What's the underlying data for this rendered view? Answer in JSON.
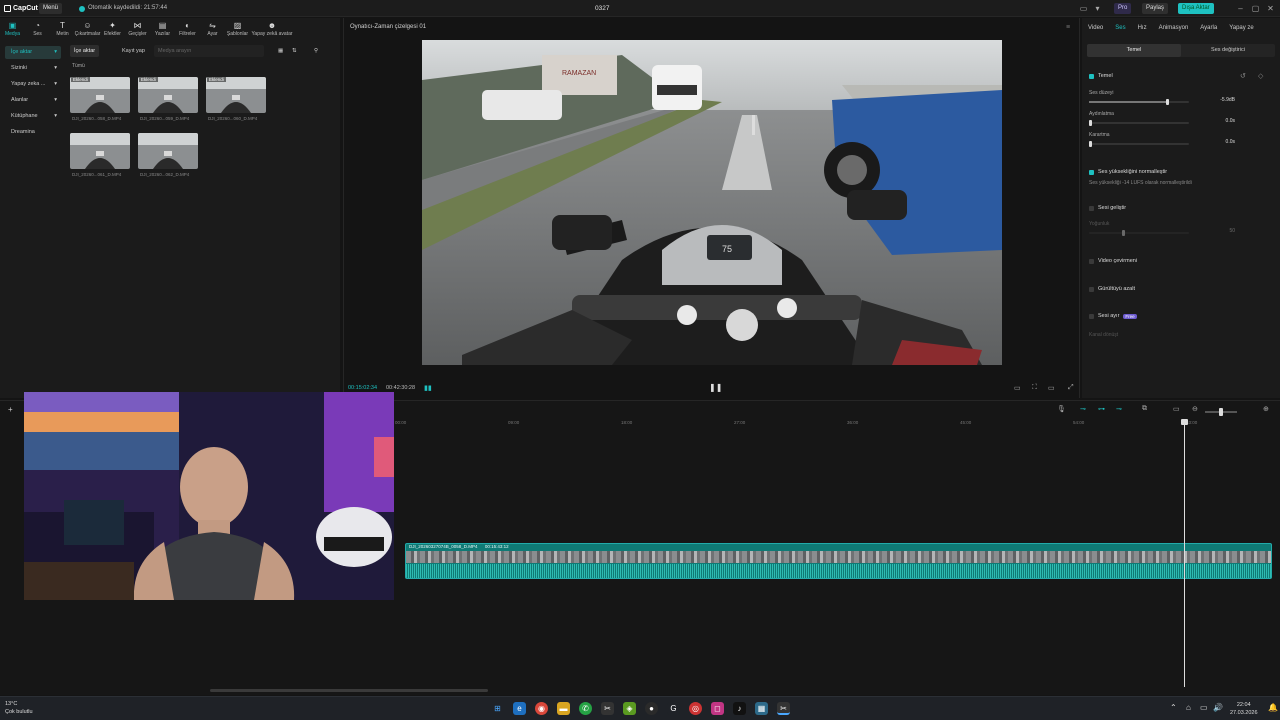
{
  "titlebar": {
    "logo": "CapCut",
    "menu": "Menü",
    "autosave": "Otomatik kaydedildi: 21:57:44",
    "project": "0327",
    "pro": "Pro",
    "share": "Paylaş",
    "export": "Dışa Aktar"
  },
  "toolbar": {
    "items": [
      {
        "label": "Medya",
        "icon": "media-icon"
      },
      {
        "label": "Ses",
        "icon": "audio-icon"
      },
      {
        "label": "Metin",
        "icon": "text-icon"
      },
      {
        "label": "Çıkartmalar",
        "icon": "sticker-icon"
      },
      {
        "label": "Efektler",
        "icon": "effects-icon"
      },
      {
        "label": "Geçişler",
        "icon": "transitions-icon"
      },
      {
        "label": "Yazılar",
        "icon": "captions-icon"
      },
      {
        "label": "Filtreler",
        "icon": "filters-icon"
      },
      {
        "label": "Ayar",
        "icon": "adjust-icon"
      },
      {
        "label": "Şablonlar",
        "icon": "templates-icon"
      },
      {
        "label": "Yapay zekâ avatar",
        "icon": "ai-avatar-icon"
      }
    ]
  },
  "sidebar": {
    "items": [
      "İçe aktar",
      "Sizinki",
      "Yapay zeka ...",
      "Alanlar",
      "Kütüphane",
      "Dreamina"
    ]
  },
  "media": {
    "import_label": "İçe aktar",
    "record_label": "Kayıt yap",
    "search_placeholder": "Medya arayın",
    "filter_all": "Tümü",
    "added_badge": "Eklendi",
    "files": [
      "DJI_20260...058_D.MP4",
      "DJI_20260...059_D.MP4",
      "DJI_20260...060_D.MP4",
      "DJI_20260...061_D.MP4",
      "DJI_20260...062_D.MP4"
    ]
  },
  "player": {
    "title": "Oynatıcı-Zaman çizelgesi 01",
    "current_time": "00:15:02:34",
    "total_time": "00:42:30:28",
    "dash_readout": "75"
  },
  "inspector": {
    "tabs": [
      "Video",
      "Ses",
      "Hız",
      "Animasyon",
      "Ayarla",
      "Yapay ze"
    ],
    "subtabs": [
      "Temel",
      "Ses değiştirici"
    ],
    "section_basic": "Temel",
    "volume_label": "Ses düzeyi",
    "volume_value": "-5.9dB",
    "volume_fraction": 0.78,
    "fadein_label": "Aydınlatma",
    "fadein_value": "0.0s",
    "fadeout_label": "Karartma",
    "fadeout_value": "0.0s",
    "normalize_label": "Ses yüksekliğini normalleştir",
    "normalize_desc": "Ses yüksekliği -14 LUFS olarak normalleştirildi",
    "enhance_label": "Sesi geliştir",
    "enhance_sub": "Yoğunluk",
    "enhance_value": "50",
    "translate_label": "Video çevirmeni",
    "noise_label": "Gürültüyü azalt",
    "isolate_label": "Sesi ayır",
    "isolate_badge": "Free",
    "channel_label": "Kanal dönüşt"
  },
  "timeline": {
    "ruler": [
      "00:00",
      "09:00",
      "18:00",
      "27:00",
      "36:00",
      "45:00",
      "54:00",
      "63:00"
    ],
    "clip_name": "DJI_20260327074B_0058_D.MP4",
    "clip_duration": "00:15:43:12",
    "playhead_fraction": 0.895
  },
  "taskbar": {
    "weather_temp": "13°C",
    "weather_text": "Çok bulutlu",
    "time": "22:04",
    "date": "27.03.2026"
  },
  "colors": {
    "accent": "#1ec1c1",
    "clip": "#0f7a75",
    "bg": "#141414",
    "panel": "#1b1b1b"
  }
}
